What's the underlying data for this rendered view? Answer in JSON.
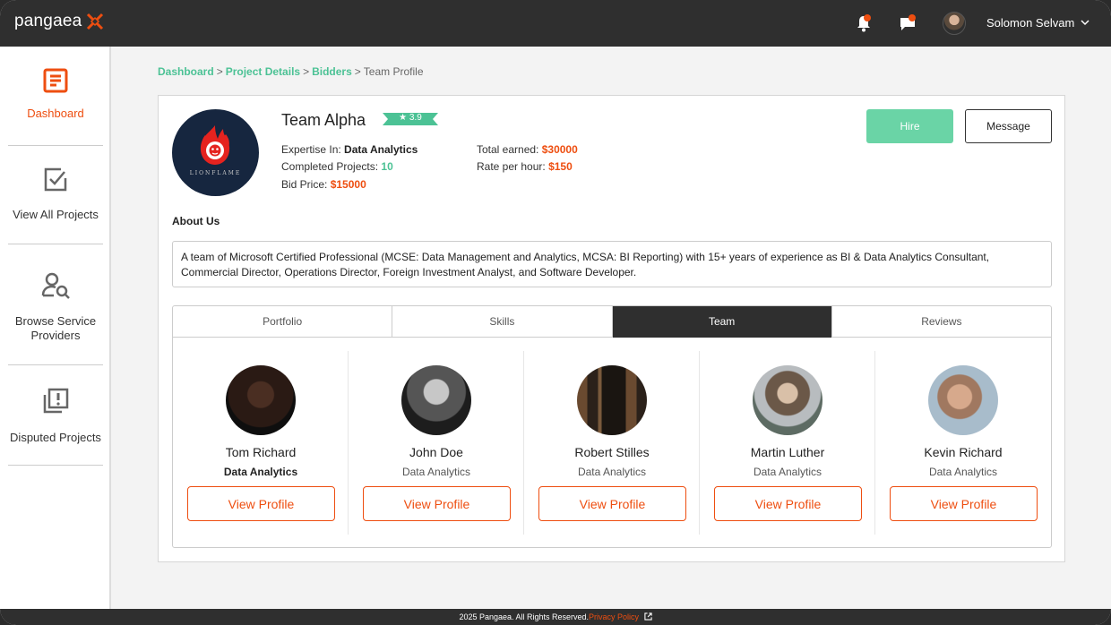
{
  "app": {
    "logo_text": "pangaea",
    "accent_color": "#ee4e10",
    "green_color": "#4cc295"
  },
  "header": {
    "user_name": "Solomon Selvam",
    "icons": [
      "bell-icon",
      "chat-icon",
      "chevron-down-icon"
    ]
  },
  "sidebar": {
    "items": [
      {
        "label": "Dashboard",
        "icon": "dashboard-icon",
        "active": true
      },
      {
        "label": "View All Projects",
        "icon": "checkbox-icon",
        "active": false
      },
      {
        "label": "Browse Service Providers",
        "icon": "user-search-icon",
        "active": false
      },
      {
        "label": "Disputed Projects",
        "icon": "alert-copy-icon",
        "active": false
      }
    ]
  },
  "breadcrumb": {
    "items": [
      "Dashboard",
      "Project Details",
      "Bidders"
    ],
    "current": "Team Profile",
    "separator": ">"
  },
  "profile": {
    "logo_word": "LIONFLAME",
    "name": "Team Alpha",
    "rating": "3.9",
    "expertise_label": "Expertise In:",
    "expertise_value": "Data Analytics",
    "completed_label": "Completed Projects:",
    "completed_value": "10",
    "bid_label": "Bid Price:",
    "bid_value": "$15000",
    "earned_label": "Total earned:",
    "earned_value": "$30000",
    "rate_label": "Rate per hour:",
    "rate_value": "$150",
    "hire_label": "Hire",
    "message_label": "Message",
    "about_title": "About Us",
    "about_text": "A team of Microsoft Certified Professional (MCSE: Data Management and Analytics, MCSA: BI Reporting) with 15+ years of experience as BI & Data Analytics Consultant, Commercial Director, Operations Director, Foreign Investment Analyst, and Software Developer."
  },
  "tabs": [
    {
      "label": "Portfolio",
      "active": false
    },
    {
      "label": "Skills",
      "active": false
    },
    {
      "label": "Team",
      "active": true
    },
    {
      "label": "Reviews",
      "active": false
    }
  ],
  "members": [
    {
      "name": "Tom Richard",
      "role": "Data Analytics",
      "button": "View Profile"
    },
    {
      "name": "John Doe",
      "role": "Data Analytics",
      "button": "View Profile"
    },
    {
      "name": "Robert Stilles",
      "role": "Data Analytics",
      "button": "View Profile"
    },
    {
      "name": "Martin Luther",
      "role": "Data Analytics",
      "button": "View Profile"
    },
    {
      "name": "Kevin Richard",
      "role": "Data Analytics",
      "button": "View Profile"
    }
  ],
  "footer": {
    "copyright": "2025 Pangaea. All Rights Reserved.",
    "privacy_label": "Privacy Policy"
  }
}
